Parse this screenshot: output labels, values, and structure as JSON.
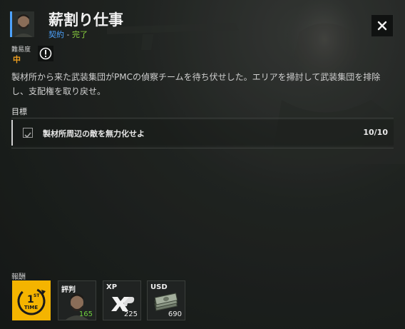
{
  "mission": {
    "title": "薪割り仕事",
    "kind": "契約",
    "separator": " - ",
    "status": "完了"
  },
  "difficulty": {
    "label": "難易度",
    "value": "中"
  },
  "description": "製材所から来た武装集団がPMCの偵察チームを待ち伏せした。エリアを掃討して武装集団を排除し、支配権を取り戻せ。",
  "objectives": {
    "header": "目標",
    "items": [
      {
        "text": "製材所周辺の敵を無力化せよ",
        "progress": "10/10",
        "completed": true
      }
    ]
  },
  "rewards": {
    "label": "報酬",
    "items": [
      {
        "kind": "first-time",
        "badge_top": "1",
        "badge_sup": "ST",
        "badge_bottom": "TIME"
      },
      {
        "kind": "reputation",
        "label": "評判",
        "amount": "165"
      },
      {
        "kind": "xp",
        "label": "XP",
        "amount": "225"
      },
      {
        "kind": "currency",
        "label": "USD",
        "amount": "690"
      }
    ]
  },
  "colors": {
    "contract": "#4da3ff",
    "complete": "#8bd13f",
    "difficulty": "#f0a020",
    "first_time_bg": "#f4b400",
    "reputation_amount": "#6fd13f"
  },
  "icons": {
    "close": "close-icon",
    "warning": "exclamation-icon",
    "checkbox": "checkbox-checked-icon"
  }
}
